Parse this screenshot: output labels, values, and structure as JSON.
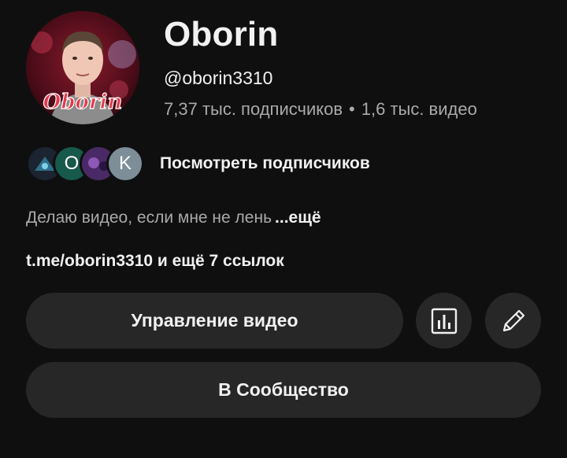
{
  "channel": {
    "name": "Oborin",
    "handle": "@oborin3310",
    "subscribers": "7,37 тыс. подписчиков",
    "separator": "•",
    "videos": "1,6 тыс. видео",
    "avatar_logo_text": "Oborin"
  },
  "subscribers_preview": {
    "avatars": [
      {
        "letter": "",
        "color": "#1b2430"
      },
      {
        "letter": "O",
        "color": "#17594a"
      },
      {
        "letter": "",
        "color": "#4a2a66"
      },
      {
        "letter": "K",
        "color": "#7d8e99"
      }
    ],
    "link_label": "Посмотреть подписчиков"
  },
  "description": {
    "text": "Делаю видео, если мне не лень",
    "more_label": "...ещё"
  },
  "links": {
    "text": "t.me/oborin3310 и ещё 7 ссылок"
  },
  "actions": {
    "manage_label": "Управление видео",
    "stats_icon": "bar-chart-icon",
    "edit_icon": "pencil-icon",
    "community_label": "В Сообщество"
  },
  "colors": {
    "background": "#0f0f0f",
    "button": "#272727",
    "text_primary": "#f1f1f1",
    "text_secondary": "#aaaaaa"
  }
}
